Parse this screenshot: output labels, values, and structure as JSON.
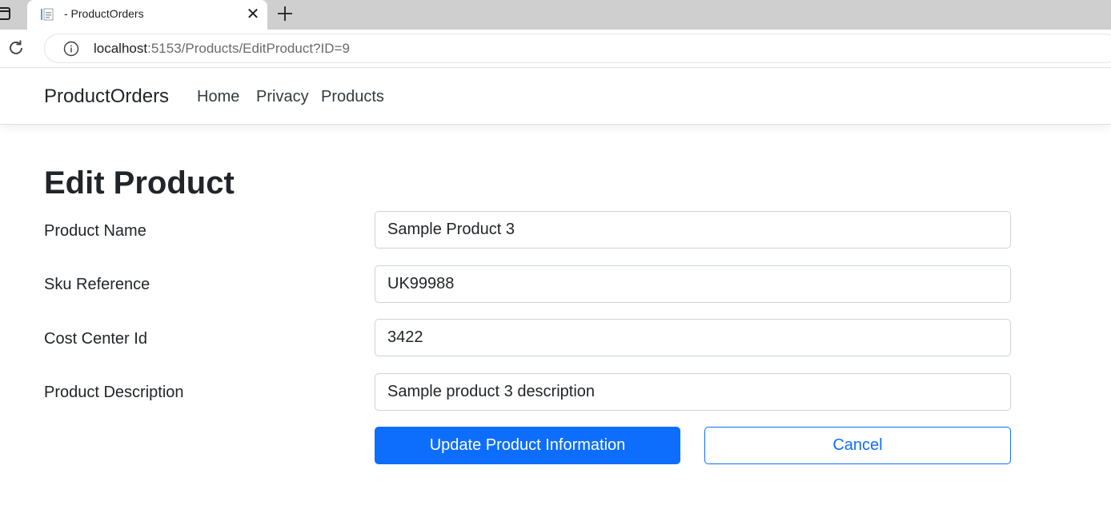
{
  "browser": {
    "tab_title": "- ProductOrders",
    "close_glyph": "✕",
    "url_host": "localhost",
    "url_rest": ":5153/Products/EditProduct?ID=9",
    "icons": [
      "window-icon",
      "page-favicon-icon",
      "close-icon",
      "plus-icon",
      "reload-icon",
      "info-icon"
    ]
  },
  "navbar": {
    "brand": "ProductOrders",
    "links": [
      {
        "label": "Home"
      },
      {
        "label": "Privacy"
      },
      {
        "label": "Products"
      }
    ]
  },
  "form": {
    "title": "Edit Product",
    "fields": [
      {
        "label": "Product Name",
        "value": "Sample Product 3"
      },
      {
        "label": "Sku Reference",
        "value": "UK99988"
      },
      {
        "label": "Cost Center Id",
        "value": "3422"
      },
      {
        "label": "Product Description",
        "value": "Sample product 3 description"
      }
    ],
    "submit_label": "Update Product Information",
    "cancel_label": "Cancel"
  },
  "colors": {
    "primary": "#0d6efd",
    "tabstrip": "#cfcfcf",
    "text": "#212529"
  }
}
